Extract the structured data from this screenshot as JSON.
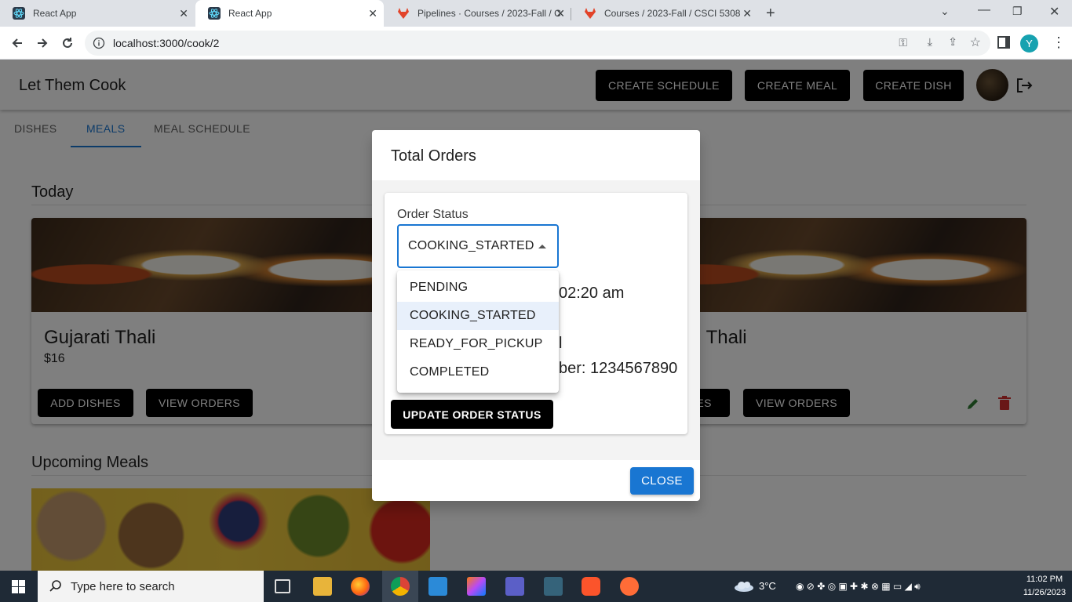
{
  "browser": {
    "tabs": [
      {
        "label": "React App",
        "icon": "react-icon"
      },
      {
        "label": "React App",
        "icon": "react-icon",
        "active": true
      },
      {
        "label": "Pipelines · Courses / 2023-Fall / C",
        "icon": "gitlab-icon"
      },
      {
        "label": "Courses / 2023-Fall / CSCI 5308",
        "icon": "gitlab-icon"
      }
    ],
    "url": "localhost:3000/cook/2",
    "profile_initial": "Y"
  },
  "app": {
    "title": "Let Them Cook",
    "actions": [
      "CREATE SCHEDULE",
      "CREATE MEAL",
      "CREATE DISH"
    ],
    "tabs": [
      "DISHES",
      "MEALS",
      "MEAL SCHEDULE"
    ],
    "active_tab": "MEALS",
    "sections": {
      "today": "Today",
      "upcoming": "Upcoming Meals"
    },
    "cards": [
      {
        "name": "Gujarati Thali",
        "price": "$16",
        "buttons": [
          "ADD DISHES",
          "VIEW ORDERS"
        ]
      },
      {
        "name_visible_fragment": "i Thali",
        "buttons_visible": [
          "IES",
          "VIEW ORDERS"
        ]
      }
    ]
  },
  "dialog": {
    "title": "Total Orders",
    "status_label": "Order Status",
    "status_value": "COOKING_STARTED",
    "options": [
      "PENDING",
      "COOKING_STARTED",
      "READY_FOR_PICKUP",
      "COMPLETED"
    ],
    "partial_time": "02:20 am",
    "partial_l": "l",
    "partial_phone": "ber: 1234567890",
    "update_button": "UPDATE ORDER STATUS",
    "close_button": "CLOSE"
  },
  "taskbar": {
    "search_placeholder": "Type here to search",
    "weather": "3°C",
    "time": "11:02 PM",
    "date": "11/26/2023"
  },
  "colors": {
    "accent_blue": "#1976d2",
    "button_black": "#000000",
    "edit_green": "#2e7d32",
    "delete_red": "#d32f2f"
  }
}
